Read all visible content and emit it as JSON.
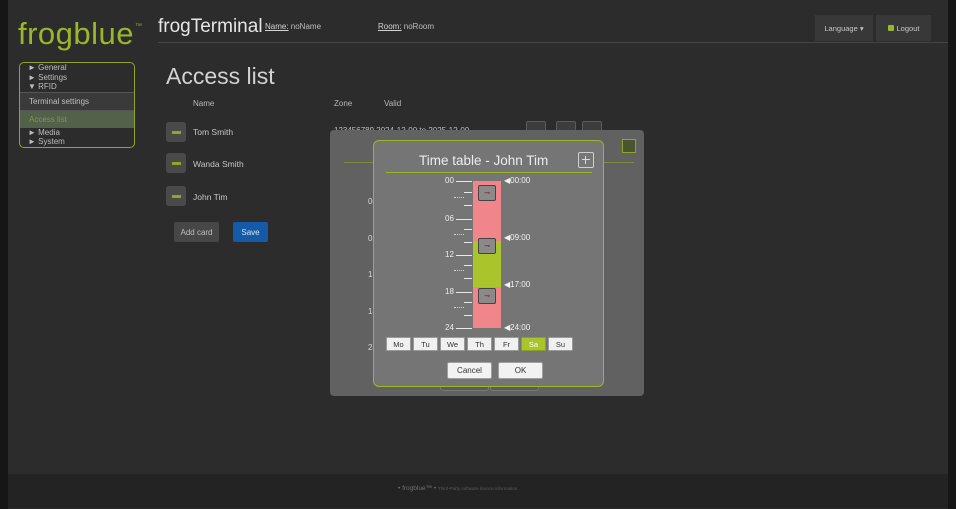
{
  "logo": {
    "text": "frogblue",
    "tm": "™"
  },
  "header": {
    "title": "frogTerminal",
    "name_label": "Name:",
    "name_value": " noName",
    "room_label": "Room:",
    "room_value": " noRoom",
    "language": "Language ▾",
    "logout": "Logout"
  },
  "sidebar": {
    "items": [
      {
        "label": "► General"
      },
      {
        "label": "► Settings"
      },
      {
        "label": "▼ RFID"
      }
    ],
    "subitems": [
      {
        "label": "Terminal settings"
      },
      {
        "label": "Access list"
      }
    ],
    "items_after": [
      {
        "label": "► Media"
      },
      {
        "label": "► System"
      }
    ]
  },
  "main": {
    "title": "Access list",
    "columns": {
      "name": "Name",
      "zone": "Zone",
      "valid": "Valid"
    },
    "rows": [
      {
        "name": "Tom Smith",
        "zone": "123456789",
        "valid": "2024-12-00 to 2025-12-00"
      },
      {
        "name": "Wanda Smith"
      },
      {
        "name": "John Tim"
      }
    ],
    "add_card": "Add card",
    "save": "Save"
  },
  "background_dialog": {
    "ticks": [
      "00",
      "06",
      "12",
      "18",
      "24"
    ]
  },
  "dialog": {
    "title": "Time table - John Tim",
    "scale_labels": [
      "00",
      "06",
      "12",
      "18",
      "24"
    ],
    "markers": [
      "◀00:00",
      "◀09:00",
      "◀17:00",
      "◀24:00"
    ],
    "intervals": [
      {
        "start": "00:00",
        "end": "09:00",
        "state": "locked",
        "color": "#f0868b"
      },
      {
        "start": "09:00",
        "end": "17:00",
        "state": "open",
        "color": "#a9c52b"
      },
      {
        "start": "17:00",
        "end": "24:00",
        "state": "locked",
        "color": "#f0868b"
      }
    ],
    "key_icon": "key-icon",
    "days": [
      "Mo",
      "Tu",
      "We",
      "Th",
      "Fr",
      "Sa",
      "Su"
    ],
    "selected_day": "Sa",
    "cancel": "Cancel",
    "ok": "OK"
  },
  "footer": {
    "text": "• frogblue™ •",
    "small": "Third-Party software licence information"
  },
  "colors": {
    "accent": "#9ab629",
    "save": "#145aa6",
    "locked": "#f0868b",
    "open": "#a9c52b"
  }
}
